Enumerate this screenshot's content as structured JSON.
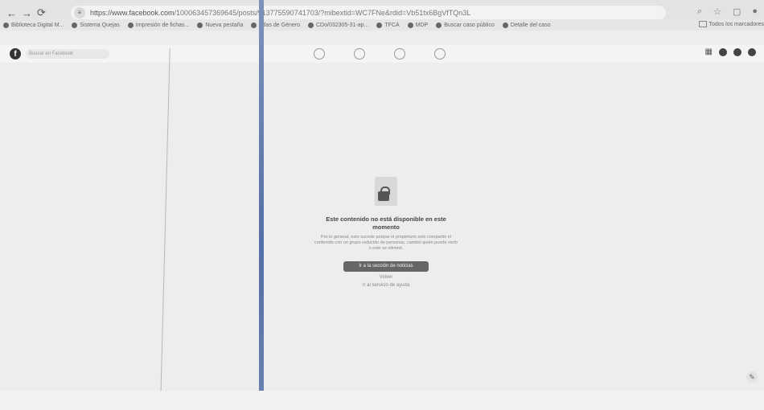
{
  "browser": {
    "url_host": "https://www.facebook.com",
    "url_path": "/100063457369645/posts/913775590741703/?mibextid=WC7FNe&rdid=Vb51tx6BgVfTQn3L",
    "bookmarks": [
      {
        "label": "Biblioteca Digital M..."
      },
      {
        "label": "Sistema Quejas"
      },
      {
        "label": "Impresión de fichas..."
      },
      {
        "label": "Nueva pestaña"
      },
      {
        "label": "Atlas de Género"
      },
      {
        "label": "CDo/032305-31-ap..."
      },
      {
        "label": "TFCA"
      },
      {
        "label": "MDP"
      },
      {
        "label": "Buscar caso público"
      },
      {
        "label": "Detalle del caso"
      }
    ],
    "all_bookmarks_label": "Todos los marcadores"
  },
  "facebook": {
    "search_placeholder": "Buscar en Facebook",
    "logo_letter": "f"
  },
  "message": {
    "title": "Este contenido no está disponible en este momento",
    "description": "Por lo general, esto sucede porque el propietario solo compartió el contenido con un grupo reducido de personas, cambió quién puede verlo o este se eliminó.",
    "primary_button": "Ir a la sección de noticias",
    "back_link": "Volver",
    "help_link": "Ir al servicio de ayuda"
  }
}
